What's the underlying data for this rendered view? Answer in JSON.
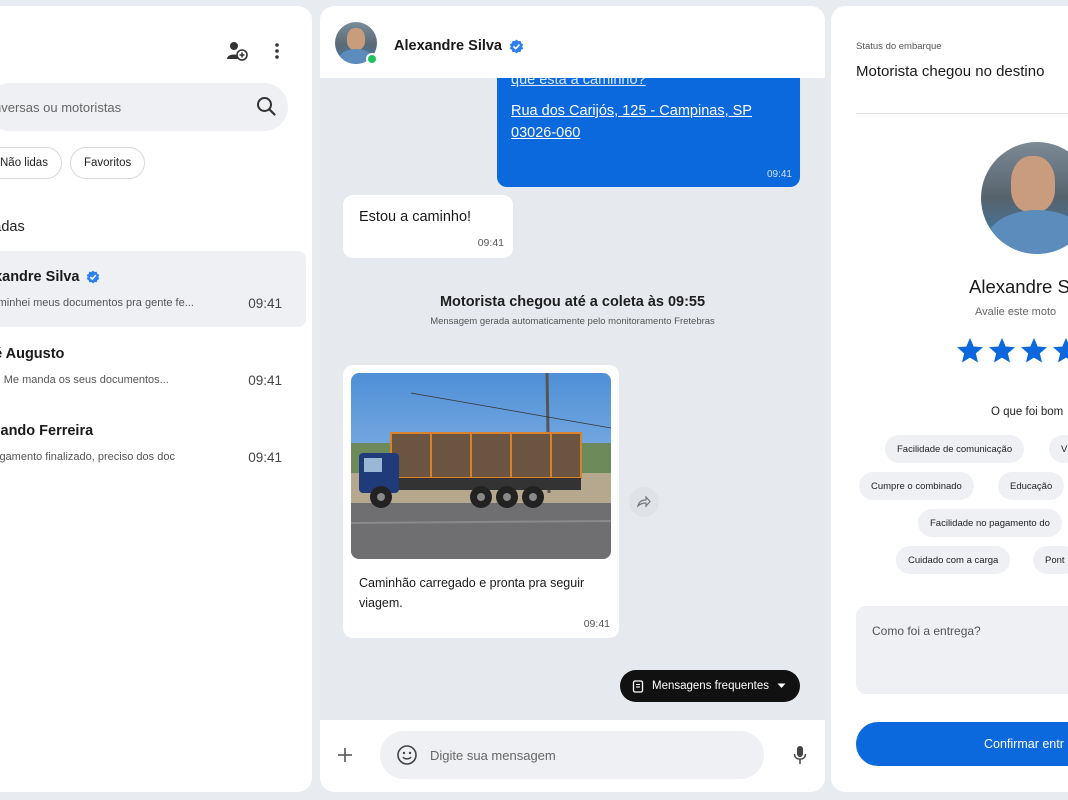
{
  "sidebar": {
    "search_placeholder": "nversas ou motoristas",
    "filters": [
      {
        "label": "Não lidas"
      },
      {
        "label": "Favoritos"
      }
    ],
    "section_title": "vadas",
    "conversations": [
      {
        "name": "exandre Silva",
        "preview": "caminhei meus documentos pra gente fe...",
        "time": "09:41",
        "verified": true
      },
      {
        "name": "sé Augusto",
        "preview": "cê: Me manda os seus documentos...",
        "time": "09:41"
      },
      {
        "name": "rnando Ferreira",
        "preview": "rregamento finalizado, preciso dos doc",
        "time": "09:41"
      }
    ]
  },
  "chat": {
    "contact_name": "Alexandre Silva",
    "messages": {
      "out_partial": "que está a caminho?",
      "out_address": "Rua dos Carijós, 125 - Campinas, SP 03026-060",
      "out_time": "09:41",
      "in1_text": "Estou a caminho!",
      "in1_time": "09:41",
      "system_title": "Motorista chegou até a coleta às 09:55",
      "system_subtitle": "Mensagem gerada automaticamente pelo monitoramento Fretebras",
      "in2_caption": "Caminhão carregado e pronta pra seguir viagem.",
      "in2_time": "09:41"
    },
    "frequent_button": "Mensagens frequentes",
    "input_placeholder": "Digite sua mensagem"
  },
  "details": {
    "status_label": "Status do embarque",
    "status_value": "Motorista chegou no destino",
    "driver_name": "Alexandre S",
    "rate_prompt": "Avalie este moto",
    "rating": 5,
    "good_title": "O que foi bom",
    "tags": [
      {
        "label": "Facilidade de comunicação"
      },
      {
        "label": "V"
      },
      {
        "label": "Cumpre o combinado"
      },
      {
        "label": "Educação"
      },
      {
        "label": "Facilidade no pagamento do"
      },
      {
        "label": "Cuidado com a carga"
      },
      {
        "label": "Pont"
      }
    ],
    "feedback_placeholder": "Como foi a entrega?",
    "confirm_button": "Confirmar entr"
  },
  "colors": {
    "accent": "#0b68dd",
    "online": "#21c25e",
    "background": "#e8ebef"
  }
}
